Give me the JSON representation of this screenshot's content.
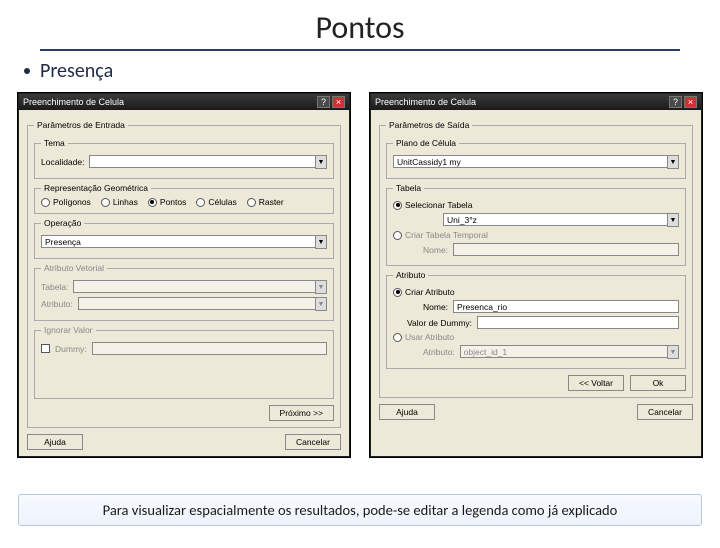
{
  "slide": {
    "title": "Pontos",
    "bullet1": "Presença",
    "footer": "Para visualizar espacialmente os resultados, pode-se editar a legenda como já explicado"
  },
  "dialog1": {
    "title": "Preenchimento de Celula",
    "group_params": "Parâmetros de Entrada",
    "group_tema": "Tema",
    "tema_label": "Localidade:",
    "tema_value": "",
    "group_rep": "Representação Geométrica",
    "rep_poligonos": "Polígonos",
    "rep_linhas": "Linhas",
    "rep_pontos": "Pontos",
    "rep_celulas": "Células",
    "rep_raster": "Raster",
    "group_oper": "Operação",
    "oper_value": "Presença",
    "group_attr_vet": "Atributo Vetorial",
    "attr_tabela": "Tabela:",
    "attr_atributo": "Atributo:",
    "group_ignorar": "Ignorar Valor",
    "ignorar_label": "Dummy:",
    "btn_proximo": "Próximo >>",
    "btn_ajuda": "Ajuda",
    "btn_cancelar": "Cancelar"
  },
  "dialog2": {
    "title": "Preenchimento de Celula",
    "group_saida": "Parâmetros de Saída",
    "group_plano": "Plano de Célula",
    "plano_value": "UnitCassidy1 my",
    "group_tabela": "Tabela",
    "selecionar_tabela": "Selecionar Tabela",
    "tabela_value": "Uni_3°z",
    "criar_temporal": "Criar Tabela Temporal",
    "nome_label": "Nome:",
    "group_atributo": "Atributo",
    "criar_atributo": "Criar Atributo",
    "atributo_nome_label": "Nome:",
    "atributo_nome_value": "Presenca_rio",
    "valor_dummy": "Valor de Dummy:",
    "usar_atributo": "Usar Atributo",
    "atributo_sel_label": "Atributo:",
    "atributo_sel_value": "object_id_1",
    "btn_voltar": "<< Voltar",
    "btn_ok": "Ok",
    "btn_ajuda": "Ajuda",
    "btn_cancelar": "Cancelar"
  }
}
